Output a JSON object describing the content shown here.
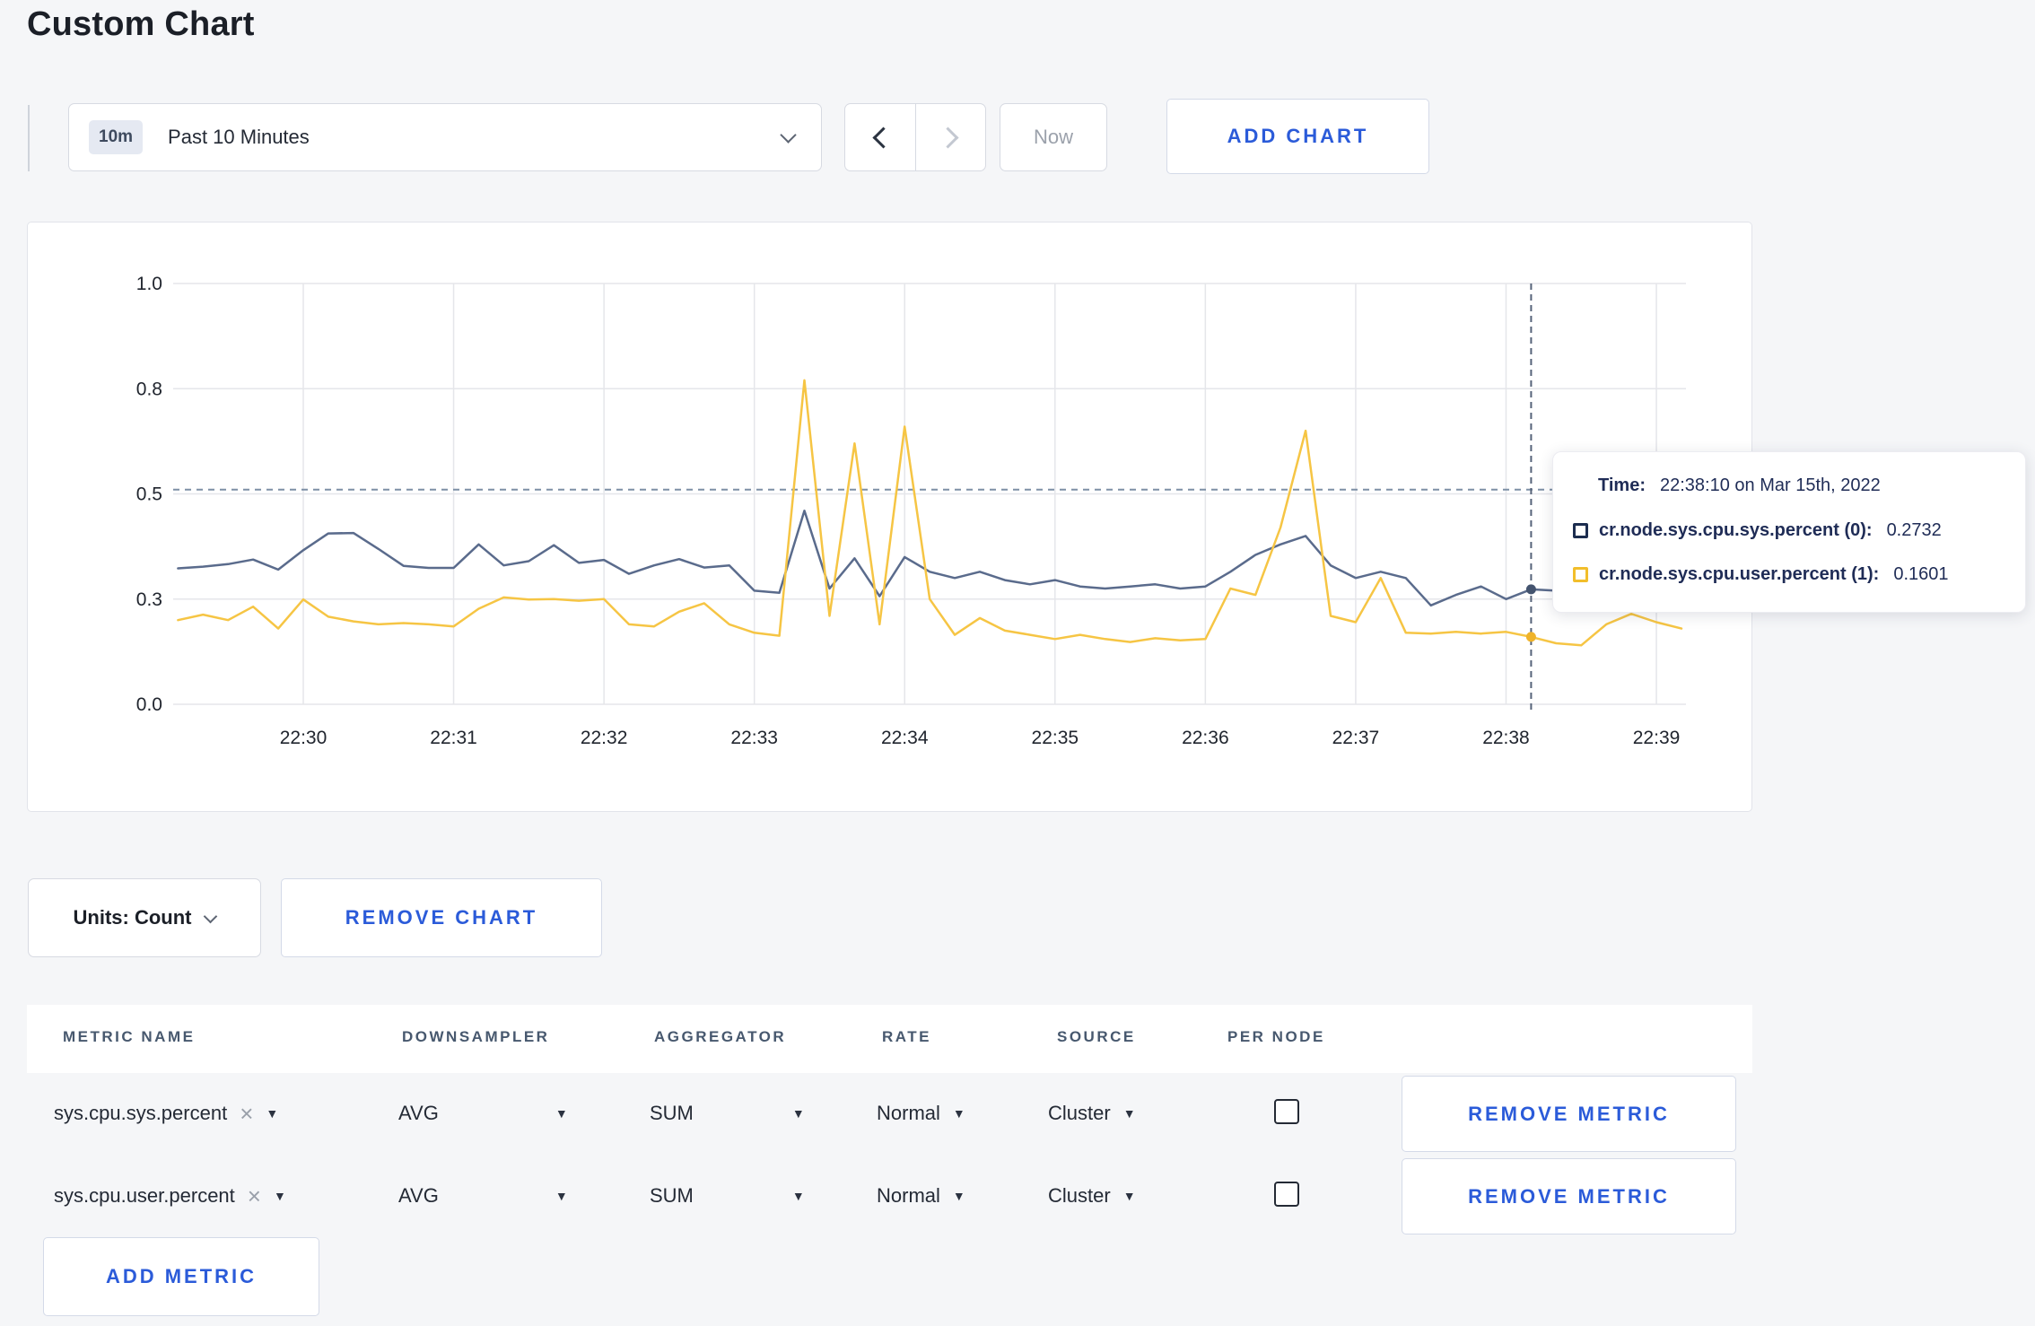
{
  "page": {
    "title": "Custom Chart"
  },
  "colors": {
    "accent_blue": "#2b5bd9",
    "series_sys_line": "#5a6b8c",
    "series_user_line": "#f6c544",
    "tooltip_swatch_sys": "#1c2d4f",
    "tooltip_swatch_user": "#f2be2b",
    "page_background": "#f5f6f8"
  },
  "toolbar": {
    "time_badge": "10m",
    "time_range_label": "Past 10 Minutes",
    "now_label": "Now",
    "add_chart_label": "ADD CHART"
  },
  "chart_data": {
    "type": "line",
    "title": "",
    "xlabel": "",
    "ylabel": "",
    "ylim": [
      0,
      1
    ],
    "grid": true,
    "y_ticks": [
      {
        "label": "1.0",
        "value": 1.0
      },
      {
        "label": "0.8",
        "value": 0.75
      },
      {
        "label": "0.5",
        "value": 0.5
      },
      {
        "label": "0.3",
        "value": 0.25
      },
      {
        "label": "0.0",
        "value": 0.0
      }
    ],
    "x_ticks": [
      "22:30",
      "22:31",
      "22:32",
      "22:33",
      "22:34",
      "22:35",
      "22:36",
      "22:37",
      "22:38",
      "22:39"
    ],
    "start_time": "22:29:10",
    "interval_seconds": 10,
    "threshold_line": 0.51,
    "crosshair_time": "22:38:10",
    "series": [
      {
        "name": "cr.node.sys.cpu.sys.percent",
        "color": "#5a6b8c",
        "dot_color": "#44546f",
        "values": [
          0.323,
          0.327,
          0.333,
          0.344,
          0.32,
          0.366,
          0.406,
          0.407,
          0.369,
          0.329,
          0.324,
          0.324,
          0.38,
          0.33,
          0.34,
          0.378,
          0.336,
          0.343,
          0.31,
          0.33,
          0.345,
          0.325,
          0.33,
          0.27,
          0.265,
          0.46,
          0.275,
          0.347,
          0.257,
          0.35,
          0.315,
          0.3,
          0.315,
          0.295,
          0.285,
          0.295,
          0.28,
          0.275,
          0.28,
          0.285,
          0.275,
          0.28,
          0.315,
          0.355,
          0.38,
          0.4,
          0.33,
          0.3,
          0.315,
          0.3,
          0.235,
          0.26,
          0.28,
          0.25,
          0.2732,
          0.27,
          0.28,
          0.275,
          0.27,
          0.28,
          0.275
        ]
      },
      {
        "name": "cr.node.sys.cpu.user.percent",
        "color": "#f6c544",
        "dot_color": "#efb32a",
        "values": [
          0.2,
          0.213,
          0.2,
          0.232,
          0.18,
          0.249,
          0.208,
          0.197,
          0.19,
          0.193,
          0.19,
          0.185,
          0.227,
          0.254,
          0.249,
          0.25,
          0.246,
          0.25,
          0.19,
          0.185,
          0.22,
          0.24,
          0.19,
          0.17,
          0.163,
          0.77,
          0.21,
          0.62,
          0.19,
          0.66,
          0.25,
          0.165,
          0.205,
          0.175,
          0.165,
          0.155,
          0.165,
          0.155,
          0.148,
          0.157,
          0.152,
          0.155,
          0.275,
          0.26,
          0.42,
          0.65,
          0.21,
          0.195,
          0.3,
          0.17,
          0.168,
          0.172,
          0.168,
          0.172,
          0.1601,
          0.145,
          0.14,
          0.19,
          0.215,
          0.195,
          0.18
        ]
      }
    ],
    "highlight": {
      "time": "22:38:10",
      "values": [
        0.2732,
        0.1601
      ]
    },
    "legend_position": "tooltip"
  },
  "tooltip": {
    "time_label": "Time:",
    "time_value": "22:38:10 on Mar 15th, 2022",
    "rows": [
      {
        "name": "cr.node.sys.cpu.sys.percent (0):",
        "value": "0.2732"
      },
      {
        "name": "cr.node.sys.cpu.user.percent (1):",
        "value": "0.1601"
      }
    ]
  },
  "units_bar": {
    "units_label": "Units: Count",
    "remove_chart_label": "REMOVE CHART"
  },
  "metrics_table": {
    "columns": [
      "METRIC NAME",
      "DOWNSAMPLER",
      "AGGREGATOR",
      "RATE",
      "SOURCE",
      "PER NODE"
    ],
    "rows": [
      {
        "metric": "sys.cpu.sys.percent",
        "clear": "×",
        "downsampler": "AVG",
        "aggregator": "SUM",
        "rate": "Normal",
        "source": "Cluster",
        "per_node_checked": false,
        "remove_label": "REMOVE METRIC"
      },
      {
        "metric": "sys.cpu.user.percent",
        "clear": "×",
        "downsampler": "AVG",
        "aggregator": "SUM",
        "rate": "Normal",
        "source": "Cluster",
        "per_node_checked": false,
        "remove_label": "REMOVE METRIC"
      }
    ],
    "add_metric_label": "ADD METRIC"
  }
}
